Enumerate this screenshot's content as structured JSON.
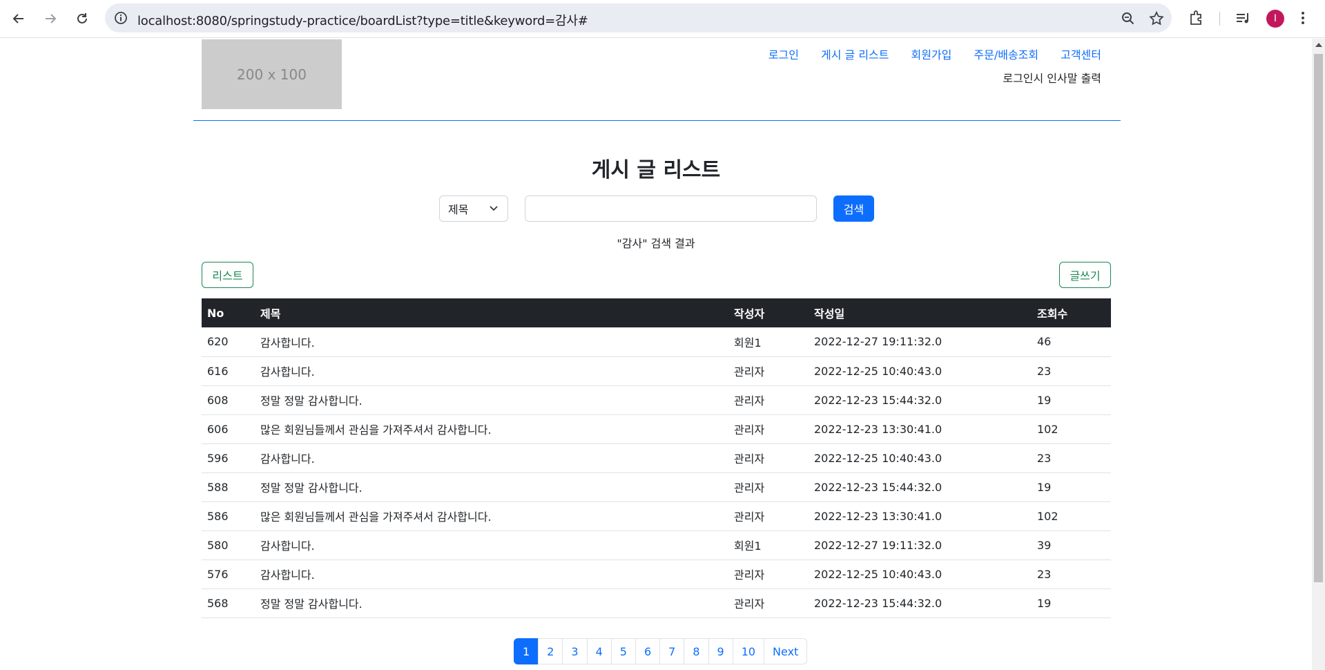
{
  "browser": {
    "url": "localhost:8080/springstudy-practice/boardList?type=title&keyword=감사#",
    "avatar_letter": "I"
  },
  "header": {
    "logo_text": "200 x 100",
    "nav": [
      "로그인",
      "게시 글 리스트",
      "회원가입",
      "주문/배송조회",
      "고객센터"
    ],
    "greeting": "로그인시 인사말 출력"
  },
  "main": {
    "title": "게시 글 리스트",
    "search": {
      "type_selected": "제목",
      "keyword_value": "",
      "button_label": "검색"
    },
    "result_text": "\"감사\" 검색 결과",
    "list_button": "리스트",
    "write_button": "글쓰기"
  },
  "table": {
    "headers": [
      "No",
      "제목",
      "작성자",
      "작성일",
      "조회수"
    ],
    "rows": [
      [
        "620",
        "감사합니다.",
        "회원1",
        "2022-12-27 19:11:32.0",
        "46"
      ],
      [
        "616",
        "감사합니다.",
        "관리자",
        "2022-12-25 10:40:43.0",
        "23"
      ],
      [
        "608",
        "정말 정말 감사합니다.",
        "관리자",
        "2022-12-23 15:44:32.0",
        "19"
      ],
      [
        "606",
        "많은 회원님들께서 관심을 가져주셔서 감사합니다.",
        "관리자",
        "2022-12-23 13:30:41.0",
        "102"
      ],
      [
        "596",
        "감사합니다.",
        "관리자",
        "2022-12-25 10:40:43.0",
        "23"
      ],
      [
        "588",
        "정말 정말 감사합니다.",
        "관리자",
        "2022-12-23 15:44:32.0",
        "19"
      ],
      [
        "586",
        "많은 회원님들께서 관심을 가져주셔서 감사합니다.",
        "관리자",
        "2022-12-23 13:30:41.0",
        "102"
      ],
      [
        "580",
        "감사합니다.",
        "회원1",
        "2022-12-27 19:11:32.0",
        "39"
      ],
      [
        "576",
        "감사합니다.",
        "관리자",
        "2022-12-25 10:40:43.0",
        "23"
      ],
      [
        "568",
        "정말 정말 감사합니다.",
        "관리자",
        "2022-12-23 15:44:32.0",
        "19"
      ]
    ]
  },
  "pagination": {
    "pages": [
      "1",
      "2",
      "3",
      "4",
      "5",
      "6",
      "7",
      "8",
      "9",
      "10"
    ],
    "active_page": "1",
    "next_label": "Next"
  },
  "colors": {
    "primary": "#0d6efd",
    "success": "#198754",
    "table_header": "#212529"
  }
}
